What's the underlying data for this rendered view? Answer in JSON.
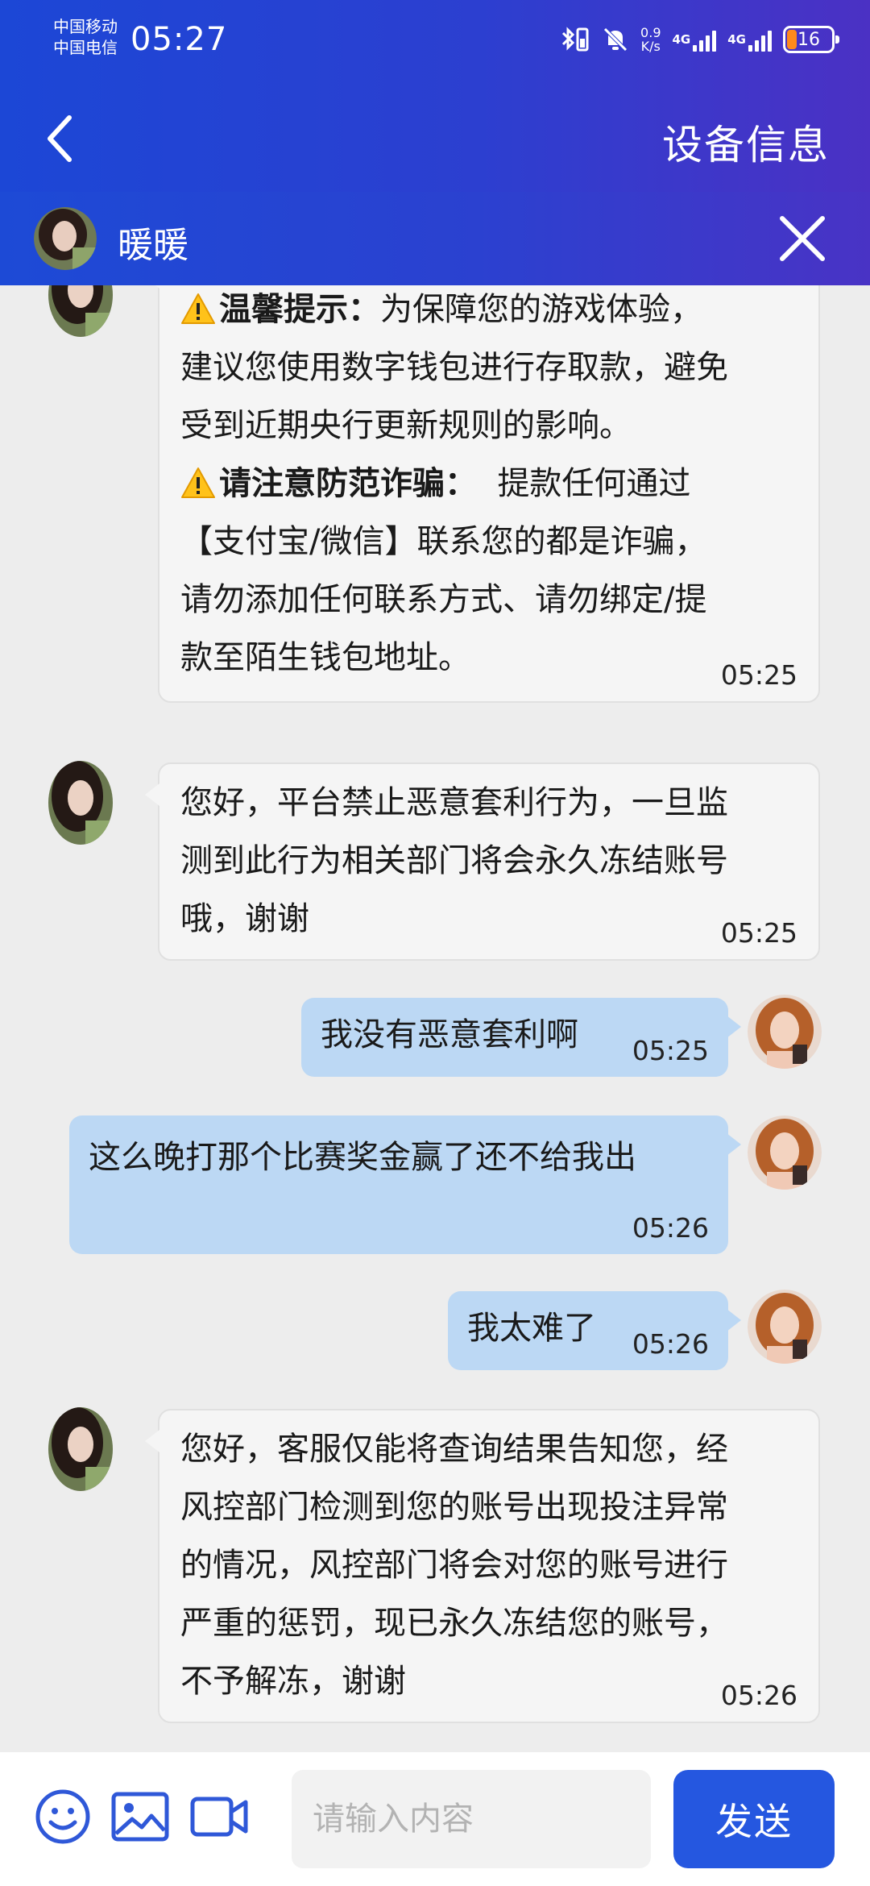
{
  "status_bar": {
    "carrier_1": "中国移动",
    "carrier_2": "中国电信",
    "time": "05:27",
    "net_speed_value": "0.9",
    "net_speed_unit": "K/s",
    "signal_1_label": "4G",
    "signal_2_label": "4G",
    "battery_level": "16",
    "battery_color": "#ff8a1c"
  },
  "nav": {
    "back_icon": "chevron-left-icon",
    "title": "设备信息"
  },
  "agent_bar": {
    "name": "暖暖",
    "close_icon": "close-icon"
  },
  "colors": {
    "header_start": "#1c47d6",
    "header_end": "#4b31c4",
    "user_bubble": "#bcd8f4",
    "agent_bubble": "#f5f5f5",
    "send_button": "#2557e0"
  },
  "messages": [
    {
      "sender": "agent",
      "warning_1_title": "温馨提示：",
      "warning_1_text": "为保障您的游戏体验，",
      "line_2": "建议您使用数字钱包进行存取款，避免",
      "line_3": "受到近期央行更新规则的影响。",
      "warning_2_title": "请注意防范诈骗：",
      "warning_2_text": "提款任何通过",
      "line_5": "【支付宝/微信】联系您的都是诈骗，",
      "line_6": "请勿添加任何联系方式、请勿绑定/提",
      "line_7": "款至陌生钱包地址。",
      "time": "05:25"
    },
    {
      "sender": "agent",
      "line_1": "您好，平台禁止恶意套利行为，一旦监",
      "line_2": "测到此行为相关部门将会永久冻结账号",
      "line_3": "哦，谢谢",
      "time": "05:25"
    },
    {
      "sender": "user",
      "text": "我没有恶意套利啊",
      "time": "05:25"
    },
    {
      "sender": "user",
      "text": "这么晚打那个比赛奖金赢了还不给我出",
      "time": "05:26"
    },
    {
      "sender": "user",
      "text": "我太难了",
      "time": "05:26"
    },
    {
      "sender": "agent",
      "line_1": "您好，客服仅能将查询结果告知您，经",
      "line_2": "风控部门检测到您的账号出现投注异常",
      "line_3": "的情况，风控部门将会对您的账号进行",
      "line_4": "严重的惩罚，现已永久冻结您的账号，",
      "line_5": "不予解冻，谢谢",
      "time": "05:26"
    }
  ],
  "input_bar": {
    "emoji_icon": "emoji-icon",
    "image_icon": "image-icon",
    "video_icon": "video-camera-icon",
    "placeholder": "请输入内容",
    "send_label": "发送"
  }
}
